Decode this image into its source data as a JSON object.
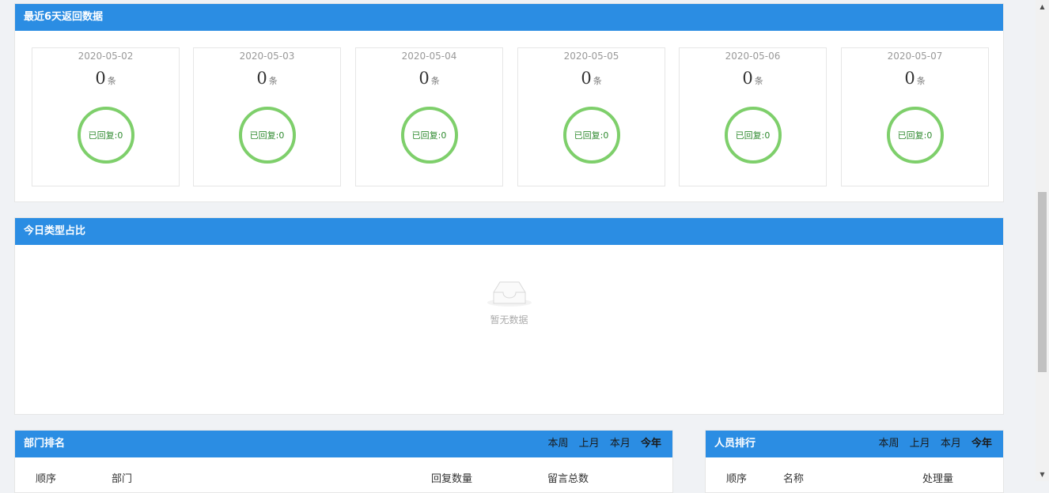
{
  "returns": {
    "title": "最近6天返回数据",
    "days": [
      {
        "date": "2020-05-02",
        "count": "0",
        "unit": "条",
        "replied": "已回复:0"
      },
      {
        "date": "2020-05-03",
        "count": "0",
        "unit": "条",
        "replied": "已回复:0"
      },
      {
        "date": "2020-05-04",
        "count": "0",
        "unit": "条",
        "replied": "已回复:0"
      },
      {
        "date": "2020-05-05",
        "count": "0",
        "unit": "条",
        "replied": "已回复:0"
      },
      {
        "date": "2020-05-06",
        "count": "0",
        "unit": "条",
        "replied": "已回复:0"
      },
      {
        "date": "2020-05-07",
        "count": "0",
        "unit": "条",
        "replied": "已回复:0"
      }
    ]
  },
  "types": {
    "title": "今日类型占比",
    "empty_text": "暂无数据"
  },
  "dept": {
    "title": "部门排名",
    "tabs": [
      "本周",
      "上月",
      "本月",
      "今年"
    ],
    "active_tab": "今年",
    "columns": [
      "顺序",
      "部门",
      "回复数量",
      "留言总数"
    ]
  },
  "staff": {
    "title": "人员排行",
    "tabs": [
      "本周",
      "上月",
      "本月",
      "今年"
    ],
    "active_tab": "今年",
    "columns": [
      "顺序",
      "名称",
      "处理量"
    ]
  },
  "colors": {
    "header": "#2b8de3",
    "ring": "#7ecf6b",
    "background": "#f0f2f5"
  },
  "icons": {
    "empty": "inbox-icon",
    "scroll_up": "arrow-up-icon",
    "scroll_down": "arrow-down-icon"
  }
}
